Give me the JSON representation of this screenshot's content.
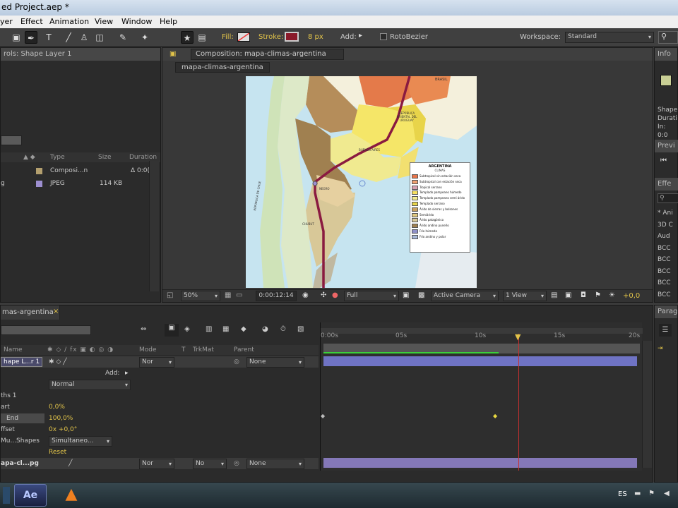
{
  "window": {
    "title": "ed Project.aep *"
  },
  "menu": {
    "items": [
      "yer",
      "Effect",
      "Animation",
      "View",
      "Window",
      "Help"
    ]
  },
  "toolbar": {
    "fill_label": "Fill:",
    "stroke_label": "Stroke:",
    "stroke_width": "8 px",
    "add_label": "Add:",
    "rotobezier_label": "RotoBezier",
    "workspace_label": "Workspace:",
    "workspace_value": "Standard"
  },
  "effect_controls": {
    "tab": "rols: Shape Layer 1"
  },
  "project": {
    "columns": [
      "Type",
      "Size",
      "Duration"
    ],
    "items": [
      {
        "name": "",
        "type": "Composi...n",
        "size": "",
        "duration": "Δ 0:0(",
        "swatch": "#b39f6e"
      },
      {
        "name": "g",
        "type": "JPEG",
        "size": "114 KB",
        "duration": "",
        "swatch": "#9d8fd0"
      }
    ]
  },
  "composition": {
    "tab": "Composition: mapa-climas-argentina",
    "breadcrumb": "mapa-climas-argentina",
    "zoom": "50%",
    "timecode": "0:00:12:14",
    "resolution": "Full",
    "camera": "Active Camera",
    "view": "1 View",
    "exposure": "+0,0"
  },
  "map": {
    "labels": [
      "BRASIL",
      "REPÚBLICA ORIENTAL DEL URUGUAY",
      "BUENOS AIRES",
      "NEGRO",
      "CHUBUT",
      "REPÚBLICA DE CHILE"
    ],
    "legend_title": "ARGENTINA",
    "legend_subtitle": "CLIMAS",
    "legend": [
      {
        "label": "Subtropical sin estación seca",
        "color": "#e8744a"
      },
      {
        "label": "Subtropical con estación seca",
        "color": "#f0a070"
      },
      {
        "label": "Tropical serrano",
        "color": "#d8a0b0"
      },
      {
        "label": "Templado pampeano húmedo",
        "color": "#f7e060"
      },
      {
        "label": "Templado pampeano semi árido",
        "color": "#f3ec90"
      },
      {
        "label": "Templado serrano",
        "color": "#e8d44a"
      },
      {
        "label": "Árido de sierras y bolsones",
        "color": "#c8a060"
      },
      {
        "label": "Semiárido",
        "color": "#e0c880"
      },
      {
        "label": "Árido patagónico",
        "color": "#d8c898"
      },
      {
        "label": "Árido andino puneño",
        "color": "#a08050"
      },
      {
        "label": "Frío húmedo",
        "color": "#9090c8"
      },
      {
        "label": "Frío andino y polar",
        "color": "#a8b8d8"
      }
    ]
  },
  "info": {
    "tab": "Info",
    "lines": [
      "Shape",
      "Durati",
      "In: 0:0"
    ]
  },
  "preview": {
    "tab": "Previ"
  },
  "effects": {
    "tab": "Effe",
    "items": [
      "* Ani",
      "3D C",
      "Aud",
      "BCC",
      "BCC",
      "BCC",
      "BCC",
      "BCC"
    ]
  },
  "paragraph": {
    "tab": "Parag"
  },
  "timeline": {
    "tab": "mas-argentina",
    "columns": {
      "name": "Name",
      "mode": "Mode",
      "t": "T",
      "trkmat": "TrkMat",
      "parent": "Parent"
    },
    "ruler": [
      "0:00s",
      "05s",
      "10s",
      "15s",
      "20s"
    ],
    "rows": [
      {
        "name": "hape L...r 1",
        "mode": "Nor",
        "parent": "None"
      },
      {
        "name": "Add:"
      },
      {
        "name": "Normal"
      },
      {
        "name": "ths 1"
      },
      {
        "name": "art",
        "value": "0,0%"
      },
      {
        "name": "End",
        "value": "100,0%"
      },
      {
        "name": "ffset",
        "value": "0x +0,0°"
      },
      {
        "name": "Mu...Shapes",
        "value": "Simultaneo..."
      },
      {
        "name": "Reset"
      },
      {
        "name": "apa-cl...pg",
        "mode": "Nor",
        "trkmat": "No",
        "parent": "None"
      }
    ]
  },
  "taskbar": {
    "lang": "ES",
    "ae_label": "Ae"
  },
  "colors": {
    "accent": "#e2c44a",
    "layer_bar": "#6f73c4",
    "layer_bar2": "#8478b8",
    "playhead": "#c83030",
    "route": "#8a1a40"
  }
}
